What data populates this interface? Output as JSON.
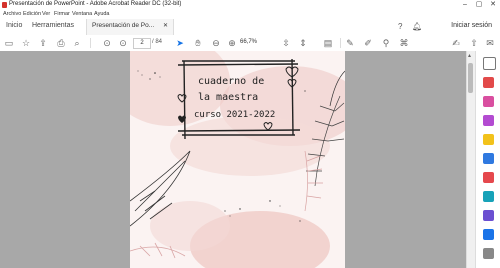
{
  "window": {
    "title": "Presentación de PowerPoint - Adobe Acrobat Reader DC (32-bit)",
    "minimize": "–",
    "maximize": "▢",
    "close": "✕"
  },
  "menu": [
    "Archivo",
    "Edición",
    "Ver",
    "Firmar",
    "Ventana",
    "Ayuda"
  ],
  "tabs": {
    "home": "Inicio",
    "tools": "Herramientas",
    "document": "Presentación de Po...",
    "close": "✕",
    "signin": "Iniciar sesión"
  },
  "toolbar": {
    "page_current": "2",
    "page_total": "/ 84",
    "zoom": "66,7%"
  },
  "document": {
    "title_lines": [
      "cuaderno de",
      "la maestra",
      "curso 2021-2022"
    ]
  },
  "colors": {
    "acrobat_red": "#d4322c",
    "workspace": "#a8a8a8",
    "page_bg": "#fbf3f2",
    "accent_blue": "#1473e6"
  }
}
